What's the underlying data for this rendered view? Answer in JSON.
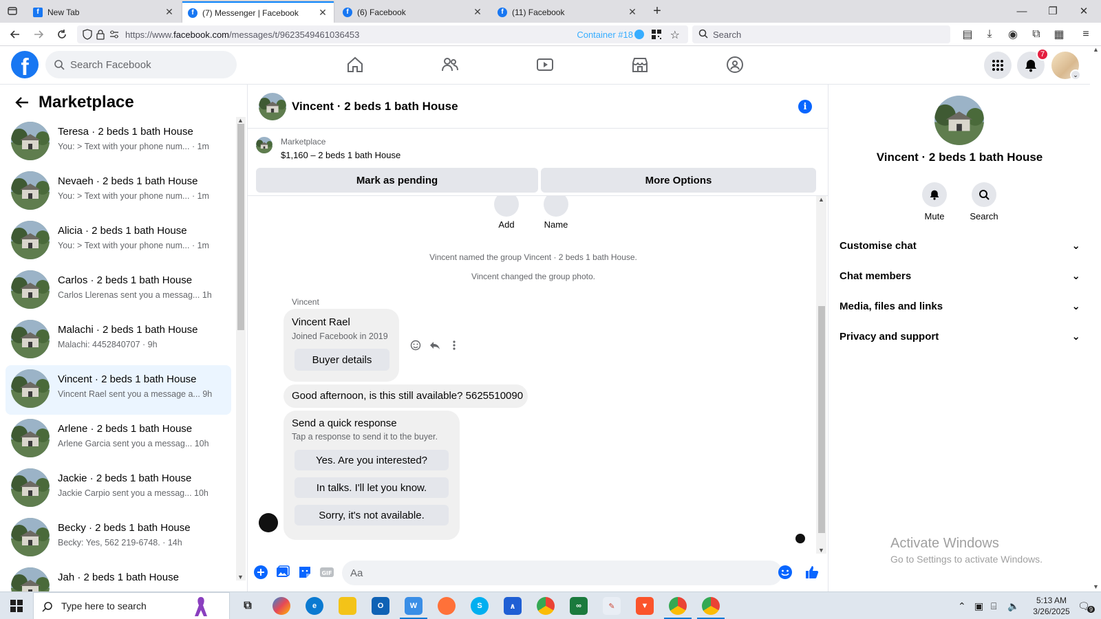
{
  "browser": {
    "tabs": [
      {
        "title": "New Tab",
        "favicon": "new-tab-icon",
        "active": false
      },
      {
        "title": "(7) Messenger | Facebook",
        "favicon": "facebook-icon",
        "active": true
      },
      {
        "title": "(6) Facebook",
        "favicon": "facebook-icon",
        "active": false
      },
      {
        "title": "(11) Facebook",
        "favicon": "facebook-icon",
        "active": false
      }
    ],
    "url_prefix": "https://www.",
    "url_domain": "facebook.com",
    "url_path": "/messages/t/9623549461036453",
    "container_label": "Container #18",
    "search_placeholder": "Search"
  },
  "fb": {
    "search_placeholder": "Search Facebook",
    "notification_count": "7",
    "brand_color": "#1877f2"
  },
  "sidebar": {
    "title": "Marketplace",
    "conversations": [
      {
        "title": "Teresa · 2 beds 1 bath House",
        "subtitle": "You: > Text with your phone num...",
        "time": "· 1m"
      },
      {
        "title": "Nevaeh · 2 beds 1 bath House",
        "subtitle": "You: > Text with your phone num...",
        "time": "· 1m"
      },
      {
        "title": "Alicia · 2 beds 1 bath House",
        "subtitle": "You: > Text with your phone num...",
        "time": "· 1m"
      },
      {
        "title": "Carlos · 2 beds 1 bath House",
        "subtitle": "Carlos Llerenas sent you a messag...",
        "time": "1h"
      },
      {
        "title": "Malachi · 2 beds 1 bath House",
        "subtitle": "Malachi: 4452840707",
        "time": "· 9h"
      },
      {
        "title": "Vincent · 2 beds 1 bath House",
        "subtitle": "Vincent Rael sent you a message a...",
        "time": "9h"
      },
      {
        "title": "Arlene · 2 beds 1 bath House",
        "subtitle": "Arlene Garcia sent you a messag...",
        "time": "10h"
      },
      {
        "title": "Jackie · 2 beds 1 bath House",
        "subtitle": "Jackie Carpio sent you a messag...",
        "time": "10h"
      },
      {
        "title": "Becky · 2 beds 1 bath House",
        "subtitle": "Becky: Yes, 562 219-6748.",
        "time": "· 14h"
      },
      {
        "title": "Jah · 2 beds 1 bath House",
        "subtitle": "",
        "time": ""
      }
    ]
  },
  "chat": {
    "title": "Vincent · 2 beds 1 bath House",
    "listing_source": "Marketplace",
    "listing_price": "$1,160 – 2 beds 1 bath House",
    "mark_pending_label": "Mark as pending",
    "more_options_label": "More Options",
    "top_actions": [
      "Add",
      "Name"
    ],
    "system_messages": [
      "Vincent named the group Vincent · 2 beds 1 bath House.",
      "Vincent changed the group photo."
    ],
    "sender_name": "Vincent",
    "profile_card": {
      "name": "Vincent Rael",
      "joined": "Joined Facebook in 2019",
      "button": "Buyer details"
    },
    "message": "Good afternoon, is this still available? 5625510090",
    "quick_response": {
      "title": "Send a quick response",
      "subtitle": "Tap a response to send it to the buyer.",
      "options": [
        "Yes. Are you interested?",
        "In talks. I'll let you know.",
        "Sorry, it's not available."
      ]
    },
    "composer_placeholder": "Aa"
  },
  "details": {
    "title": "Vincent · 2 beds 1 bath House",
    "actions": [
      "Mute",
      "Search"
    ],
    "sections": [
      "Customise chat",
      "Chat members",
      "Media, files and links",
      "Privacy and support"
    ],
    "watermark_title": "Activate Windows",
    "watermark_sub": "Go to Settings to activate Windows."
  },
  "taskbar": {
    "search_placeholder": "Type here to search",
    "time": "5:13 AM",
    "date": "3/26/2025",
    "notification_count": "9"
  }
}
